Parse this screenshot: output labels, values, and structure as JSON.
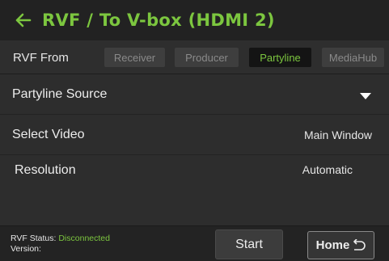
{
  "header": {
    "title": "RVF / To V-box (HDMI 2)"
  },
  "rvf_from": {
    "label": "RVF From",
    "options": [
      "Receiver",
      "Producer",
      "Partyline",
      "MediaHub"
    ],
    "selected": "Partyline"
  },
  "partyline_source": {
    "label": "Partyline Source"
  },
  "select_video": {
    "label": "Select Video",
    "value": "Main Window"
  },
  "resolution": {
    "label": "Resolution",
    "value": "Automatic"
  },
  "footer": {
    "status_label": "RVF Status:",
    "status_value": "Disconnected",
    "version_label": "Version:",
    "start_label": "Start",
    "home_label": "Home"
  },
  "colors": {
    "accent": "#7cc63f",
    "background": "#2d2d2d",
    "header_bg": "#222222"
  }
}
